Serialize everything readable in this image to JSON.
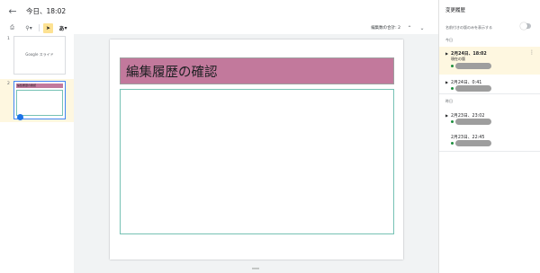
{
  "header": {
    "back_icon": "arrow-back-icon",
    "title": "今日、18:02"
  },
  "toolbar": {
    "print_icon": "printer-icon",
    "zoom_icon": "zoom-icon",
    "cursor_icon": "cursor-arrow-icon",
    "text_tool": "あ",
    "edit_count": "編集数の合計: 2",
    "prev_icon": "chevron-up-icon",
    "next_icon": "chevron-down-icon"
  },
  "thumbnails": [
    {
      "number": "1",
      "text": "Google スライド"
    },
    {
      "number": "2",
      "text": "編集履歴の確認"
    }
  ],
  "slide": {
    "title": "編集履歴の確認"
  },
  "panel": {
    "title": "変更履歴",
    "toggle_label": "名前付きの版のみを表示する",
    "groups": [
      {
        "label": "今日",
        "versions": [
          {
            "time": "2月24日、18:02",
            "label": "現在の版",
            "selected": true
          },
          {
            "time": "2月24日、0:41",
            "label": "",
            "selected": false
          }
        ]
      },
      {
        "label": "昨日",
        "versions": [
          {
            "time": "2月23日、23:02",
            "label": "",
            "selected": false
          },
          {
            "time": "2月23日、22:45",
            "label": "",
            "selected": false
          }
        ]
      }
    ]
  },
  "colors": {
    "title_box": "#c2799c",
    "body_border": "#76c2b4",
    "selected_bg": "#fef7e0",
    "author_dot": "#1e8e3e"
  }
}
